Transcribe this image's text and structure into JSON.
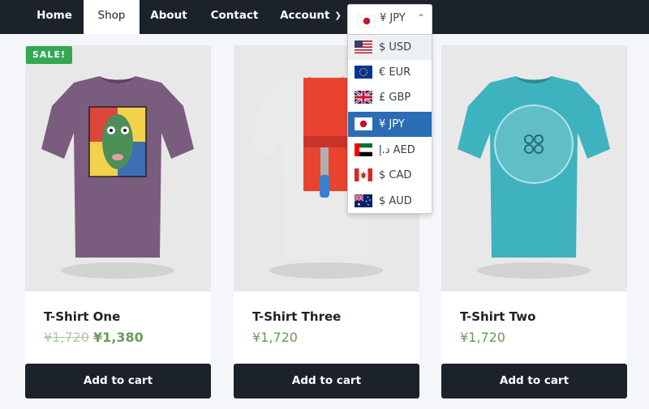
{
  "nav": {
    "items": [
      {
        "label": "Home"
      },
      {
        "label": "Shop"
      },
      {
        "label": "About"
      },
      {
        "label": "Contact"
      },
      {
        "label": "Account"
      }
    ],
    "active": "Shop"
  },
  "currency": {
    "selected_label": "¥ JPY",
    "selected_flag": "jp-flag-icon",
    "options": [
      {
        "label": "$ USD",
        "flag": "us-flag-icon"
      },
      {
        "label": "€ EUR",
        "flag": "eu-flag-icon"
      },
      {
        "label": "£ GBP",
        "flag": "gb-flag-icon"
      },
      {
        "label": "¥ JPY",
        "flag": "jp-flag-icon"
      },
      {
        "label": "د.إ AED",
        "flag": "ae-flag-icon"
      },
      {
        "label": "$ CAD",
        "flag": "ca-flag-icon"
      },
      {
        "label": "$ AUD",
        "flag": "au-flag-icon"
      }
    ],
    "hovered": "$ USD",
    "selected": "¥ JPY"
  },
  "products": [
    {
      "title": "T-Shirt One",
      "badge": "SALE!",
      "price_old": "¥1,720",
      "price": "¥1,380",
      "button": "Add to cart",
      "shirt_color": "#7a5c7e"
    },
    {
      "title": "T-Shirt Three",
      "price": "¥1,720",
      "button": "Add to cart",
      "shirt_color": "#e9e9e9"
    },
    {
      "title": "T-Shirt Two",
      "price": "¥1,720",
      "button": "Add to cart",
      "shirt_color": "#3fb2bf"
    }
  ],
  "colors": {
    "nav_bg": "#1b2229",
    "accent_green": "#34a853",
    "price_green": "#6a9a5c",
    "selected_blue": "#2a6db5"
  }
}
